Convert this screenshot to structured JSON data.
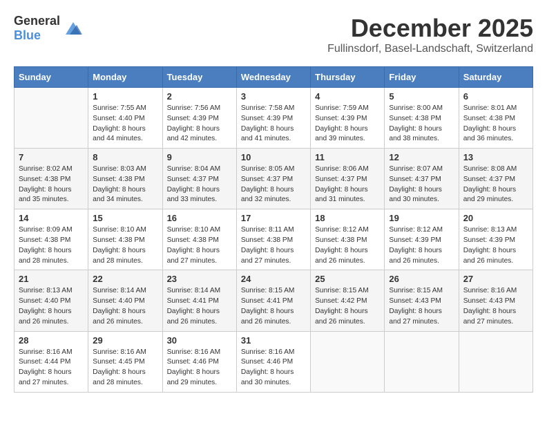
{
  "header": {
    "logo_general": "General",
    "logo_blue": "Blue",
    "month": "December 2025",
    "location": "Fullinsdorf, Basel-Landschaft, Switzerland"
  },
  "weekdays": [
    "Sunday",
    "Monday",
    "Tuesday",
    "Wednesday",
    "Thursday",
    "Friday",
    "Saturday"
  ],
  "weeks": [
    [
      {
        "day": "",
        "info": ""
      },
      {
        "day": "1",
        "info": "Sunrise: 7:55 AM\nSunset: 4:40 PM\nDaylight: 8 hours\nand 44 minutes."
      },
      {
        "day": "2",
        "info": "Sunrise: 7:56 AM\nSunset: 4:39 PM\nDaylight: 8 hours\nand 42 minutes."
      },
      {
        "day": "3",
        "info": "Sunrise: 7:58 AM\nSunset: 4:39 PM\nDaylight: 8 hours\nand 41 minutes."
      },
      {
        "day": "4",
        "info": "Sunrise: 7:59 AM\nSunset: 4:39 PM\nDaylight: 8 hours\nand 39 minutes."
      },
      {
        "day": "5",
        "info": "Sunrise: 8:00 AM\nSunset: 4:38 PM\nDaylight: 8 hours\nand 38 minutes."
      },
      {
        "day": "6",
        "info": "Sunrise: 8:01 AM\nSunset: 4:38 PM\nDaylight: 8 hours\nand 36 minutes."
      }
    ],
    [
      {
        "day": "7",
        "info": "Sunrise: 8:02 AM\nSunset: 4:38 PM\nDaylight: 8 hours\nand 35 minutes."
      },
      {
        "day": "8",
        "info": "Sunrise: 8:03 AM\nSunset: 4:38 PM\nDaylight: 8 hours\nand 34 minutes."
      },
      {
        "day": "9",
        "info": "Sunrise: 8:04 AM\nSunset: 4:37 PM\nDaylight: 8 hours\nand 33 minutes."
      },
      {
        "day": "10",
        "info": "Sunrise: 8:05 AM\nSunset: 4:37 PM\nDaylight: 8 hours\nand 32 minutes."
      },
      {
        "day": "11",
        "info": "Sunrise: 8:06 AM\nSunset: 4:37 PM\nDaylight: 8 hours\nand 31 minutes."
      },
      {
        "day": "12",
        "info": "Sunrise: 8:07 AM\nSunset: 4:37 PM\nDaylight: 8 hours\nand 30 minutes."
      },
      {
        "day": "13",
        "info": "Sunrise: 8:08 AM\nSunset: 4:37 PM\nDaylight: 8 hours\nand 29 minutes."
      }
    ],
    [
      {
        "day": "14",
        "info": "Sunrise: 8:09 AM\nSunset: 4:38 PM\nDaylight: 8 hours\nand 28 minutes."
      },
      {
        "day": "15",
        "info": "Sunrise: 8:10 AM\nSunset: 4:38 PM\nDaylight: 8 hours\nand 28 minutes."
      },
      {
        "day": "16",
        "info": "Sunrise: 8:10 AM\nSunset: 4:38 PM\nDaylight: 8 hours\nand 27 minutes."
      },
      {
        "day": "17",
        "info": "Sunrise: 8:11 AM\nSunset: 4:38 PM\nDaylight: 8 hours\nand 27 minutes."
      },
      {
        "day": "18",
        "info": "Sunrise: 8:12 AM\nSunset: 4:38 PM\nDaylight: 8 hours\nand 26 minutes."
      },
      {
        "day": "19",
        "info": "Sunrise: 8:12 AM\nSunset: 4:39 PM\nDaylight: 8 hours\nand 26 minutes."
      },
      {
        "day": "20",
        "info": "Sunrise: 8:13 AM\nSunset: 4:39 PM\nDaylight: 8 hours\nand 26 minutes."
      }
    ],
    [
      {
        "day": "21",
        "info": "Sunrise: 8:13 AM\nSunset: 4:40 PM\nDaylight: 8 hours\nand 26 minutes."
      },
      {
        "day": "22",
        "info": "Sunrise: 8:14 AM\nSunset: 4:40 PM\nDaylight: 8 hours\nand 26 minutes."
      },
      {
        "day": "23",
        "info": "Sunrise: 8:14 AM\nSunset: 4:41 PM\nDaylight: 8 hours\nand 26 minutes."
      },
      {
        "day": "24",
        "info": "Sunrise: 8:15 AM\nSunset: 4:41 PM\nDaylight: 8 hours\nand 26 minutes."
      },
      {
        "day": "25",
        "info": "Sunrise: 8:15 AM\nSunset: 4:42 PM\nDaylight: 8 hours\nand 26 minutes."
      },
      {
        "day": "26",
        "info": "Sunrise: 8:15 AM\nSunset: 4:43 PM\nDaylight: 8 hours\nand 27 minutes."
      },
      {
        "day": "27",
        "info": "Sunrise: 8:16 AM\nSunset: 4:43 PM\nDaylight: 8 hours\nand 27 minutes."
      }
    ],
    [
      {
        "day": "28",
        "info": "Sunrise: 8:16 AM\nSunset: 4:44 PM\nDaylight: 8 hours\nand 27 minutes."
      },
      {
        "day": "29",
        "info": "Sunrise: 8:16 AM\nSunset: 4:45 PM\nDaylight: 8 hours\nand 28 minutes."
      },
      {
        "day": "30",
        "info": "Sunrise: 8:16 AM\nSunset: 4:46 PM\nDaylight: 8 hours\nand 29 minutes."
      },
      {
        "day": "31",
        "info": "Sunrise: 8:16 AM\nSunset: 4:46 PM\nDaylight: 8 hours\nand 30 minutes."
      },
      {
        "day": "",
        "info": ""
      },
      {
        "day": "",
        "info": ""
      },
      {
        "day": "",
        "info": ""
      }
    ]
  ]
}
